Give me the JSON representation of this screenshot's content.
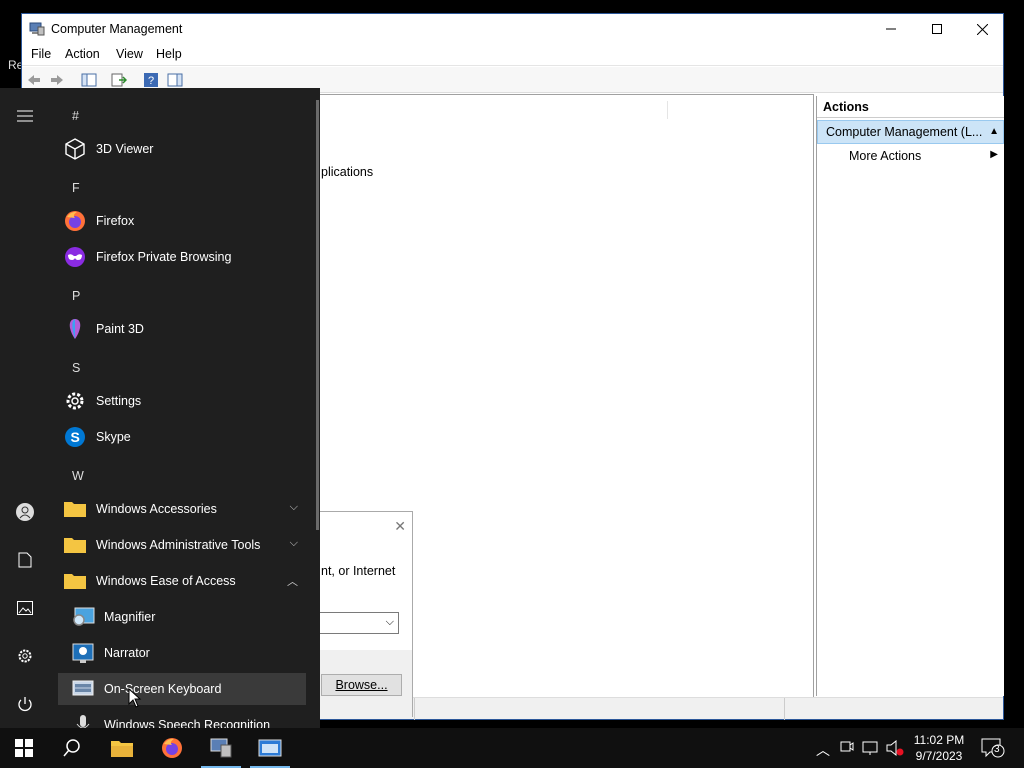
{
  "desktop": {
    "partial_label": "Re"
  },
  "window": {
    "title": "Computer Management",
    "menu": [
      "File",
      "Action",
      "View",
      "Help"
    ],
    "content_partial_text": "plications",
    "actions": {
      "title": "Actions",
      "section": "Computer Management (L...",
      "item": "More Actions"
    }
  },
  "dialog": {
    "desc": "nt, or Internet",
    "browse_label": "Browse..."
  },
  "start_menu": {
    "headers": {
      "hash": "#",
      "f": "F",
      "p": "P",
      "s": "S",
      "w": "W"
    },
    "items": {
      "viewer3d": "3D Viewer",
      "firefox": "Firefox",
      "firefox_private": "Firefox Private Browsing",
      "paint3d": "Paint 3D",
      "settings": "Settings",
      "skype": "Skype",
      "win_accessories": "Windows Accessories",
      "win_admin_tools": "Windows Administrative Tools",
      "win_ease": "Windows Ease of Access",
      "magnifier": "Magnifier",
      "narrator": "Narrator",
      "osk": "On-Screen Keyboard",
      "speech": "Windows Speech Recognition"
    }
  },
  "taskbar": {
    "time": "11:02 PM",
    "date": "9/7/2023",
    "notification_count": "3"
  },
  "colors": {
    "accent": "#0078d7",
    "selection": "#cce4f7",
    "start_bg": "#1f1f1f",
    "taskbar_bg": "#101010"
  }
}
